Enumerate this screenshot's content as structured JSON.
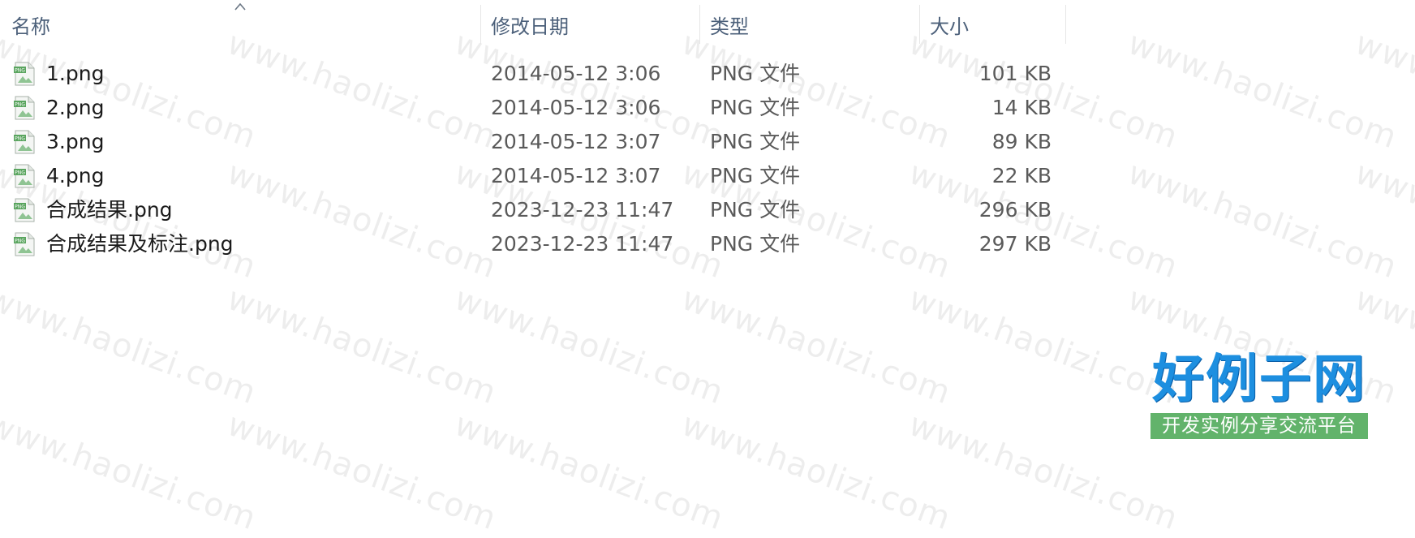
{
  "columns": {
    "name": "名称",
    "modified": "修改日期",
    "type": "类型",
    "size": "大小"
  },
  "sort": {
    "column": "name",
    "direction": "ascending"
  },
  "files": [
    {
      "name": "1.png",
      "modified": "2014-05-12 3:06",
      "type": "PNG 文件",
      "size": "101 KB",
      "icon": "png-file-icon"
    },
    {
      "name": "2.png",
      "modified": "2014-05-12 3:06",
      "type": "PNG 文件",
      "size": "14 KB",
      "icon": "png-file-icon"
    },
    {
      "name": "3.png",
      "modified": "2014-05-12 3:07",
      "type": "PNG 文件",
      "size": "89 KB",
      "icon": "png-file-icon"
    },
    {
      "name": "4.png",
      "modified": "2014-05-12 3:07",
      "type": "PNG 文件",
      "size": "22 KB",
      "icon": "png-file-icon"
    },
    {
      "name": "合成结果.png",
      "modified": "2023-12-23 11:47",
      "type": "PNG 文件",
      "size": "296 KB",
      "icon": "png-file-icon"
    },
    {
      "name": "合成结果及标注.png",
      "modified": "2023-12-23 11:47",
      "type": "PNG 文件",
      "size": "297 KB",
      "icon": "png-file-icon"
    }
  ],
  "watermark": {
    "text": "www.haolizi.com"
  },
  "logo": {
    "title": "好例子网",
    "subtitle": "开发实例分享交流平台"
  },
  "colors": {
    "header_text": "#4c607a",
    "logo_blue": "#1d8fe0",
    "logo_green": "#62b36b"
  }
}
